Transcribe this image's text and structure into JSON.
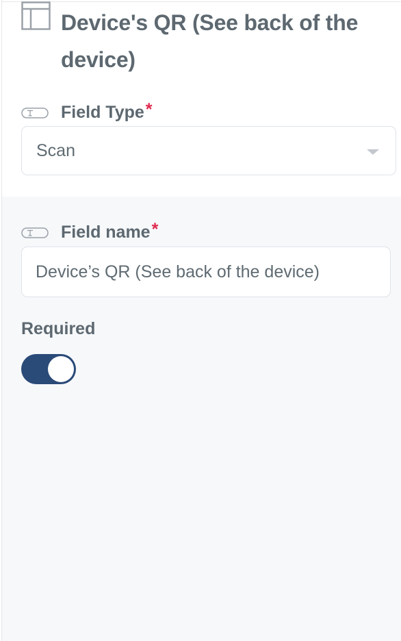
{
  "header": {
    "icon": "layout-panel-icon",
    "title_line1": "Device's QR (See back of the",
    "title_line2": "device)"
  },
  "field_type": {
    "icon": "text-field-icon",
    "label": "Field Type",
    "required_marker": "*",
    "selected_value": "Scan"
  },
  "field_name": {
    "icon": "text-field-icon",
    "label": "Field name",
    "required_marker": "*",
    "value": "Device’s QR (See back of the device)"
  },
  "required": {
    "label": "Required",
    "enabled": true
  },
  "colors": {
    "toggle_on": "#2a4a78",
    "required_star": "#e0294e",
    "panel_bg": "#f6f8fa"
  }
}
